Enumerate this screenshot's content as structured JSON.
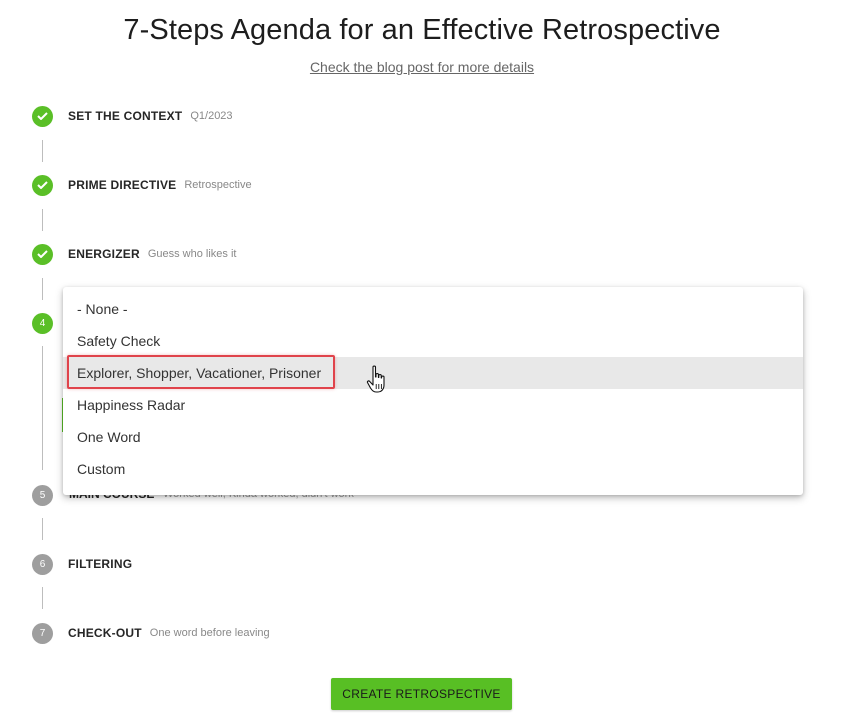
{
  "header": {
    "title": "7-Steps Agenda for an Effective Retrospective",
    "link": "Check the blog post for more details"
  },
  "steps": [
    {
      "number": "1",
      "title": "SET THE CONTEXT",
      "subtitle": "Q1/2023",
      "state": "done"
    },
    {
      "number": "2",
      "title": "PRIME DIRECTIVE",
      "subtitle": "Retrospective",
      "state": "done"
    },
    {
      "number": "3",
      "title": "ENERGIZER",
      "subtitle": "Guess who likes it",
      "state": "done"
    },
    {
      "number": "4",
      "title": "",
      "subtitle": "",
      "state": "active"
    },
    {
      "number": "5",
      "title": "MAIN COURSE",
      "subtitle": "Worked well, Kinda worked, didn't work",
      "state": "pending"
    },
    {
      "number": "6",
      "title": "FILTERING",
      "subtitle": "",
      "state": "pending"
    },
    {
      "number": "7",
      "title": "CHECK-OUT",
      "subtitle": "One word before leaving",
      "state": "pending"
    }
  ],
  "dropdown": {
    "options": [
      "- None -",
      "Safety Check",
      "Explorer, Shopper, Vacationer, Prisoner",
      "Happiness Radar",
      "One Word",
      "Custom"
    ],
    "hovered_index": 2
  },
  "actions": {
    "create_label": "CREATE RETROSPECTIVE"
  },
  "colors": {
    "accent_green": "#5abf27",
    "pending_grey": "#9e9e9e",
    "highlight_red": "#e0434b"
  }
}
